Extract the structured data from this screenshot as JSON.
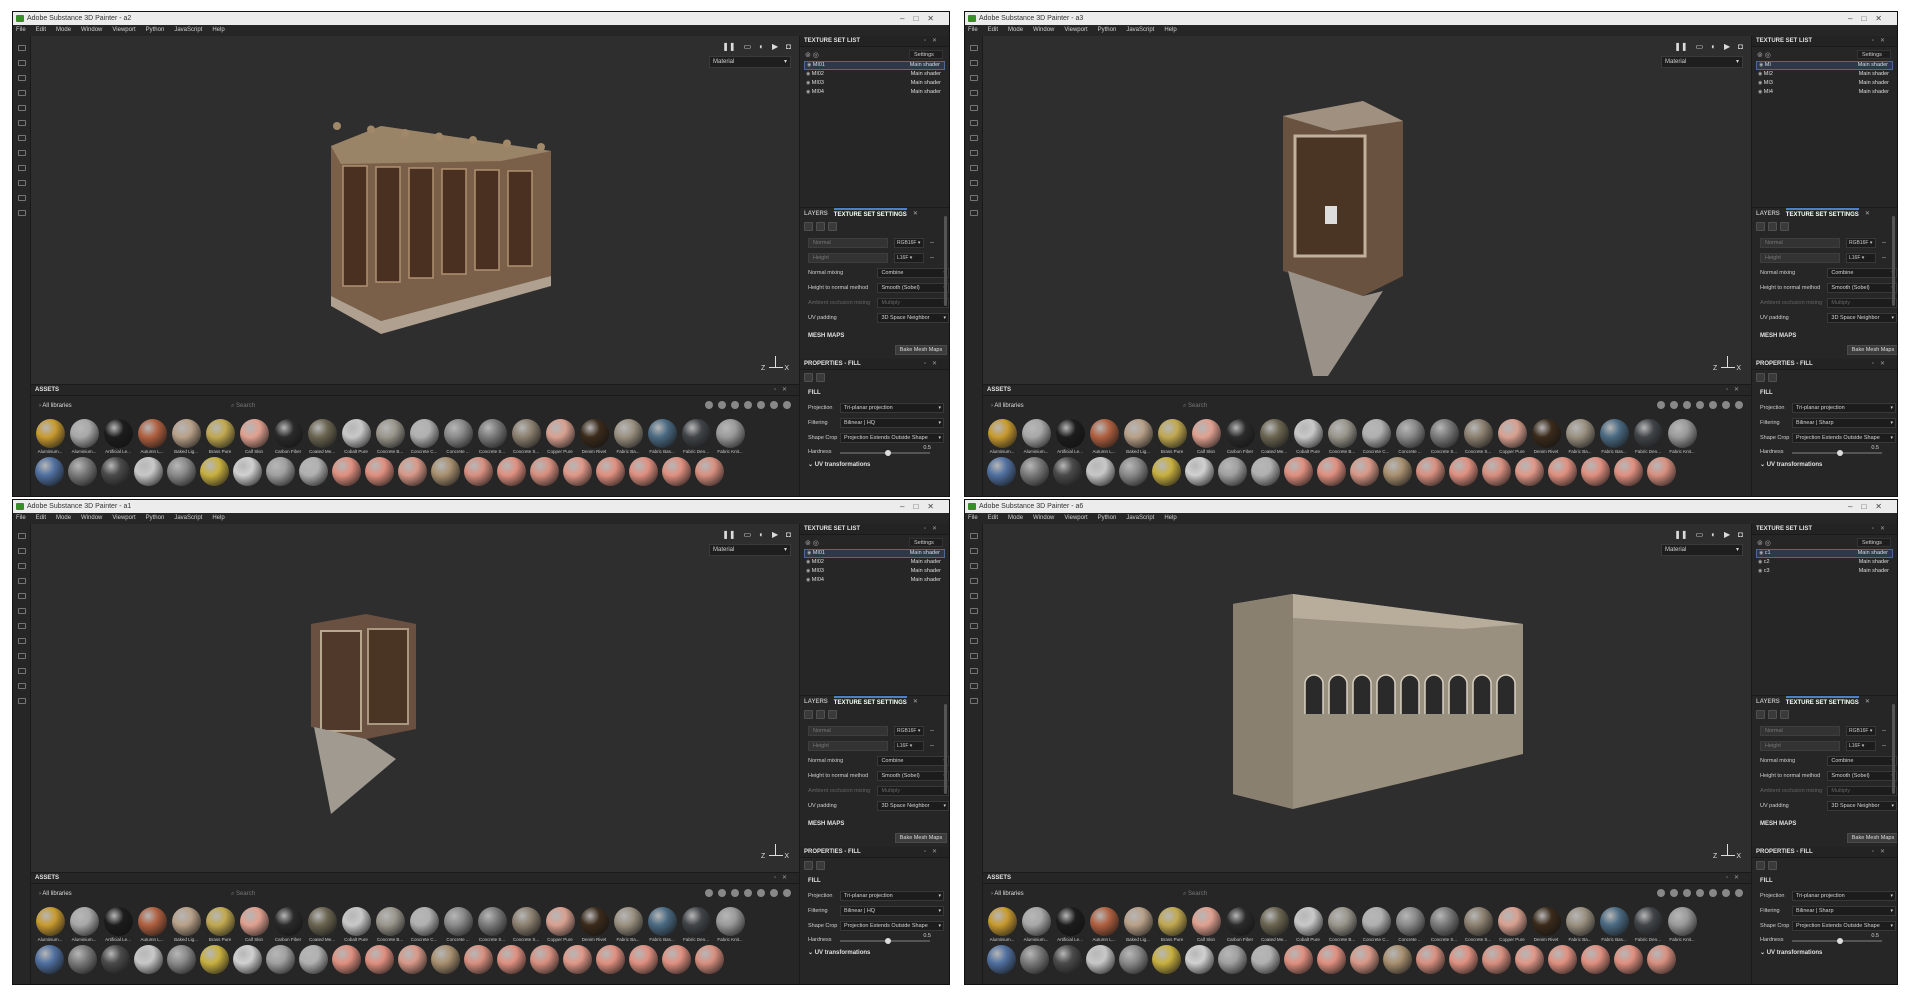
{
  "windows": [
    {
      "title": "Adobe Substance 3D Painter - a2",
      "set_prefix": "MI",
      "model": "mashrabiya-wide"
    },
    {
      "title": "Adobe Substance 3D Painter - a3",
      "set_prefix": "MI",
      "model": "mashrabiya-tall"
    },
    {
      "title": "Adobe Substance 3D Painter - a1",
      "set_prefix": "MI",
      "model": "mashrabiya-narrow"
    },
    {
      "title": "Adobe Substance 3D Painter - a6",
      "set_prefix": "c",
      "model": "arcade-facade"
    }
  ],
  "menu": [
    "File",
    "Edit",
    "Mode",
    "Window",
    "Viewport",
    "Python",
    "JavaScript",
    "Help"
  ],
  "viewport": {
    "material_select": "Material",
    "axis_z": "Z",
    "axis_x": "X"
  },
  "texture_set_list": {
    "title": "TEXTURE SET LIST",
    "settings_label": "Settings",
    "sets_a": [
      {
        "name": "MI01",
        "shader": "Main shader"
      },
      {
        "name": "MI02",
        "shader": "Main shader"
      },
      {
        "name": "MI03",
        "shader": "Main shader"
      },
      {
        "name": "MI04",
        "shader": "Main shader"
      }
    ],
    "sets_b": [
      {
        "name": "MI",
        "shader": "Main shader"
      },
      {
        "name": "MI2",
        "shader": "Main shader"
      },
      {
        "name": "MI3",
        "shader": "Main shader"
      },
      {
        "name": "MI4",
        "shader": "Main shader"
      }
    ],
    "sets_d": [
      {
        "name": "c1",
        "shader": "Main shader"
      },
      {
        "name": "c2",
        "shader": "Main shader"
      },
      {
        "name": "c3",
        "shader": "Main shader"
      }
    ]
  },
  "layers_tabs": {
    "layers": "LAYERS",
    "tss": "TEXTURE SET SETTINGS"
  },
  "tss": {
    "normal_label": "Normal",
    "normal_fmt": "RGB16F",
    "height_label": "Height",
    "height_fmt": "L16F",
    "rows": [
      {
        "label": "Normal mixing",
        "value": "Combine",
        "dim": false
      },
      {
        "label": "Height to normal method",
        "value": "Smooth (Sobel)",
        "dim": false
      },
      {
        "label": "Ambient occlusion mixing",
        "value": "Multiply",
        "dim": true
      },
      {
        "label": "UV padding",
        "value": "3D Space Neighbor",
        "dim": false
      }
    ],
    "mesh_maps": "MESH MAPS",
    "bake_button": "Bake Mesh Maps"
  },
  "properties": {
    "title": "PROPERTIES - FILL",
    "fill": "FILL",
    "projection_label": "Projection",
    "projection_value": "Tri-planar projection",
    "filtering_label": "Filtering",
    "filtering_hq": "Bilinear | HQ",
    "filtering_sharp": "Bilinear | Sharp",
    "shape_crop_label": "Shape Crop",
    "shape_crop_value": "Projection Extends Outside Shape",
    "hardness_label": "Hardness",
    "hardness_value": "0.5",
    "uv_transformations": "UV transformations"
  },
  "assets": {
    "title": "ASSETS",
    "libraries": "All libraries",
    "search_placeholder": "Search",
    "materials": [
      {
        "label": "Aluminium...",
        "color": "#c89a30"
      },
      {
        "label": "Aluminium...",
        "color": "#a8a8a8"
      },
      {
        "label": "Artificial Le...",
        "color": "#1c1c1c"
      },
      {
        "label": "Autumn L...",
        "color": "#b06040"
      },
      {
        "label": "Baked Lig...",
        "color": "#b8a088"
      },
      {
        "label": "Brass Pure",
        "color": "#c0a850"
      },
      {
        "label": "Calf Skin",
        "color": "#e0a090"
      },
      {
        "label": "Carbon Fiber",
        "color": "#2a2a2a"
      },
      {
        "label": "Coated Me...",
        "color": "#6a6450"
      },
      {
        "label": "Cobalt Pure",
        "color": "#c8c8c8"
      },
      {
        "label": "Concrete B...",
        "color": "#9a968c"
      },
      {
        "label": "Concrete C...",
        "color": "#b0b0b0"
      },
      {
        "label": "Concrete ...",
        "color": "#8a8a8a"
      },
      {
        "label": "Concrete S...",
        "color": "#7a7a7a"
      },
      {
        "label": "Concrete S...",
        "color": "#8c8070"
      },
      {
        "label": "Copper Pure",
        "color": "#d8a090"
      },
      {
        "label": "Denim Rivet",
        "color": "#3a2a1a"
      },
      {
        "label": "Fabric Ba...",
        "color": "#9a9080"
      },
      {
        "label": "Fabric Bas...",
        "color": "#4a6a82"
      },
      {
        "label": "Fabric Den...",
        "color": "#404448"
      },
      {
        "label": "Fabric Knit...",
        "color": "#9a9a9a"
      }
    ],
    "row2_colors": [
      "#5070a0",
      "#7a7a7a",
      "#4a4a4a",
      "#c8c8c8",
      "#8a8a8a",
      "#c8b040",
      "#d0d0d0",
      "#a0a0a0",
      "#b0b0b0",
      "#e09080",
      "#e09080",
      "#d89888",
      "#a89070",
      "#d89080",
      "#e09080",
      "#d89080",
      "#e09888",
      "#e09080",
      "#e09080",
      "#e09080",
      "#d89080"
    ]
  }
}
